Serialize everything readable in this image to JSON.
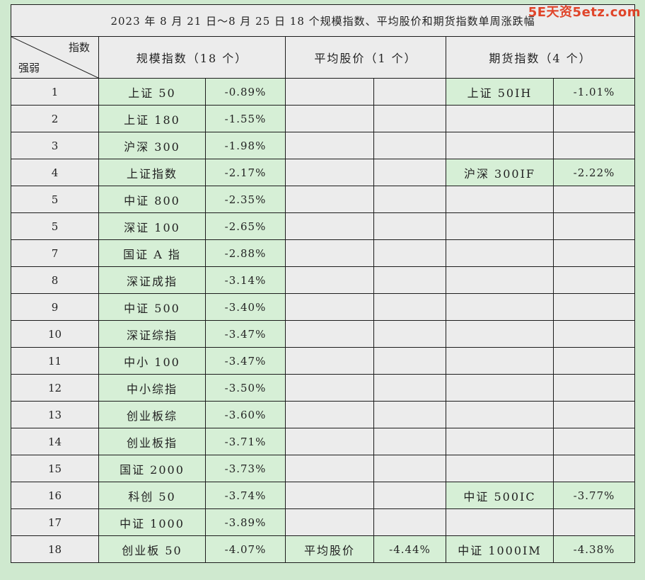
{
  "watermark": "5E天资5etz.com",
  "title": "2023 年 8 月 21 日～8 月 25 日 18 个规模指数、平均股价和期货指数单周涨跌幅",
  "header": {
    "corner_top": "指数",
    "corner_bottom": "强弱",
    "col_scale": "规模指数（18 个）",
    "col_avg": "平均股价（1 个）",
    "col_futures": "期货指数（4 个）"
  },
  "colors": {
    "highlight": "#d6efd6",
    "empty": "#ececec",
    "background": "#cfe9cf"
  },
  "rows": [
    {
      "rank": "1",
      "scale_name": "上证 50",
      "scale_pct": "-0.89%",
      "avg_name": "",
      "avg_pct": "",
      "fut_name": "上证 50IH",
      "fut_pct": "-1.01%"
    },
    {
      "rank": "2",
      "scale_name": "上证 180",
      "scale_pct": "-1.55%",
      "avg_name": "",
      "avg_pct": "",
      "fut_name": "",
      "fut_pct": ""
    },
    {
      "rank": "3",
      "scale_name": "沪深 300",
      "scale_pct": "-1.98%",
      "avg_name": "",
      "avg_pct": "",
      "fut_name": "",
      "fut_pct": ""
    },
    {
      "rank": "4",
      "scale_name": "上证指数",
      "scale_pct": "-2.17%",
      "avg_name": "",
      "avg_pct": "",
      "fut_name": "沪深 300IF",
      "fut_pct": "-2.22%"
    },
    {
      "rank": "5",
      "scale_name": "中证 800",
      "scale_pct": "-2.35%",
      "avg_name": "",
      "avg_pct": "",
      "fut_name": "",
      "fut_pct": ""
    },
    {
      "rank": "5",
      "scale_name": "深证 100",
      "scale_pct": "-2.65%",
      "avg_name": "",
      "avg_pct": "",
      "fut_name": "",
      "fut_pct": ""
    },
    {
      "rank": "7",
      "scale_name": "国证 A 指",
      "scale_pct": "-2.88%",
      "avg_name": "",
      "avg_pct": "",
      "fut_name": "",
      "fut_pct": ""
    },
    {
      "rank": "8",
      "scale_name": "深证成指",
      "scale_pct": "-3.14%",
      "avg_name": "",
      "avg_pct": "",
      "fut_name": "",
      "fut_pct": ""
    },
    {
      "rank": "9",
      "scale_name": "中证 500",
      "scale_pct": "-3.40%",
      "avg_name": "",
      "avg_pct": "",
      "fut_name": "",
      "fut_pct": ""
    },
    {
      "rank": "10",
      "scale_name": "深证综指",
      "scale_pct": "-3.47%",
      "avg_name": "",
      "avg_pct": "",
      "fut_name": "",
      "fut_pct": ""
    },
    {
      "rank": "11",
      "scale_name": "中小 100",
      "scale_pct": "-3.47%",
      "avg_name": "",
      "avg_pct": "",
      "fut_name": "",
      "fut_pct": ""
    },
    {
      "rank": "12",
      "scale_name": "中小综指",
      "scale_pct": "-3.50%",
      "avg_name": "",
      "avg_pct": "",
      "fut_name": "",
      "fut_pct": ""
    },
    {
      "rank": "13",
      "scale_name": "创业板综",
      "scale_pct": "-3.60%",
      "avg_name": "",
      "avg_pct": "",
      "fut_name": "",
      "fut_pct": ""
    },
    {
      "rank": "14",
      "scale_name": "创业板指",
      "scale_pct": "-3.71%",
      "avg_name": "",
      "avg_pct": "",
      "fut_name": "",
      "fut_pct": ""
    },
    {
      "rank": "15",
      "scale_name": "国证 2000",
      "scale_pct": "-3.73%",
      "avg_name": "",
      "avg_pct": "",
      "fut_name": "",
      "fut_pct": ""
    },
    {
      "rank": "16",
      "scale_name": "科创 50",
      "scale_pct": "-3.74%",
      "avg_name": "",
      "avg_pct": "",
      "fut_name": "中证 500IC",
      "fut_pct": "-3.77%"
    },
    {
      "rank": "17",
      "scale_name": "中证 1000",
      "scale_pct": "-3.89%",
      "avg_name": "",
      "avg_pct": "",
      "fut_name": "",
      "fut_pct": ""
    },
    {
      "rank": "18",
      "scale_name": "创业板 50",
      "scale_pct": "-4.07%",
      "avg_name": "平均股价",
      "avg_pct": "-4.44%",
      "fut_name": "中证 1000IM",
      "fut_pct": "-4.38%"
    }
  ]
}
